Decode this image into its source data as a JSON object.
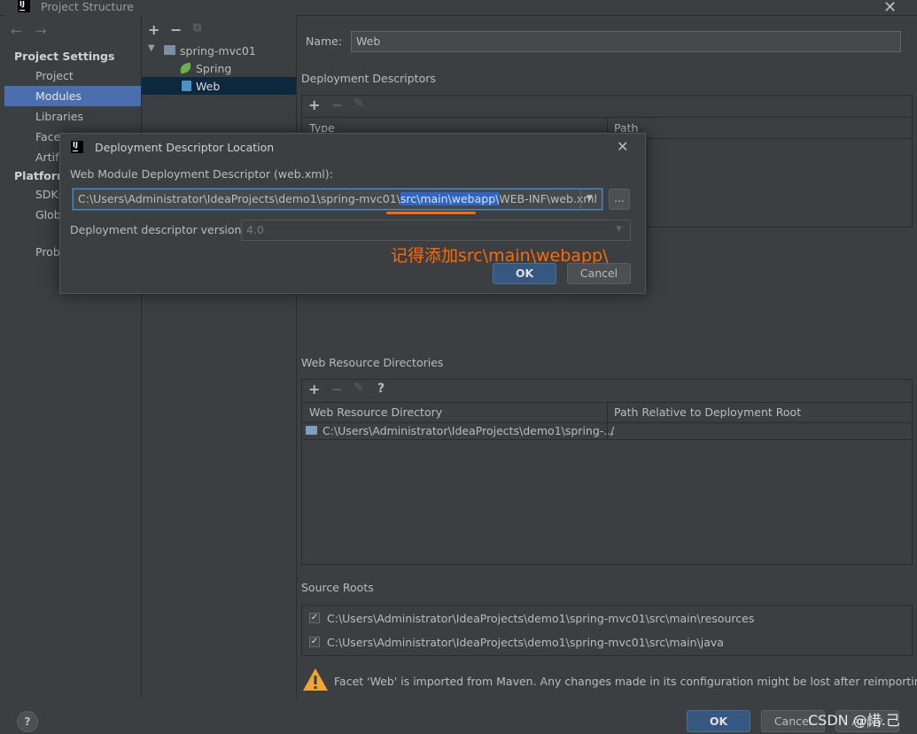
{
  "window": {
    "title": "Project Structure"
  },
  "nav": {
    "back": "←",
    "forward": "→",
    "project_settings": "Project Settings",
    "items_project": [
      "Project",
      "Modules",
      "Libraries",
      "Facet",
      "Artif"
    ],
    "platform": "Platform",
    "items_platform": [
      "SDKs",
      "Glob"
    ],
    "problems": "Prob"
  },
  "tree": {
    "add": "+",
    "remove": "−",
    "copy": "⧉",
    "root": "spring-mvc01",
    "children": [
      "Spring",
      "Web"
    ]
  },
  "details": {
    "name_label": "Name:",
    "name_value": "Web",
    "deployment_descriptors": "Deployment Descriptors",
    "dd_columns": [
      "Type",
      "Path"
    ],
    "web_resource_dirs": "Web Resource Directories",
    "wrd_columns": [
      "Web Resource Directory",
      "Path Relative to Deployment Root"
    ],
    "wrd_row": {
      "dir": "C:\\Users\\Administrator\\IdeaProjects\\demo1\\spring-...",
      "path": "/"
    },
    "help": "?",
    "source_roots": "Source Roots",
    "source_root_items": [
      "C:\\Users\\Administrator\\IdeaProjects\\demo1\\spring-mvc01\\src\\main\\resources",
      "C:\\Users\\Administrator\\IdeaProjects\\demo1\\spring-mvc01\\src\\main\\java"
    ],
    "warning": "Facet 'Web' is imported from Maven. Any changes made in its configuration might be lost after reimporting."
  },
  "footer": {
    "ok": "OK",
    "cancel": "Cancel",
    "apply": "Apply",
    "help": "?"
  },
  "dialog": {
    "title": "Deployment Descriptor Location",
    "field_label": "Web Module Deployment Descriptor (web.xml):",
    "path_prefix": "C:\\Users\\Administrator\\IdeaProjects\\demo1\\spring-mvc01\\",
    "path_highlight": "src\\main\\webapp\\",
    "path_suffix": "WEB-INF\\web.xml",
    "browse": "...",
    "version_label": "Deployment descriptor version",
    "version_value": "4.0",
    "annotation": "记得添加src\\main\\webapp\\",
    "ok": "OK",
    "cancel": "Cancel",
    "annotation_color": "#ff6a00"
  },
  "watermark": "CSDN @惜.己"
}
